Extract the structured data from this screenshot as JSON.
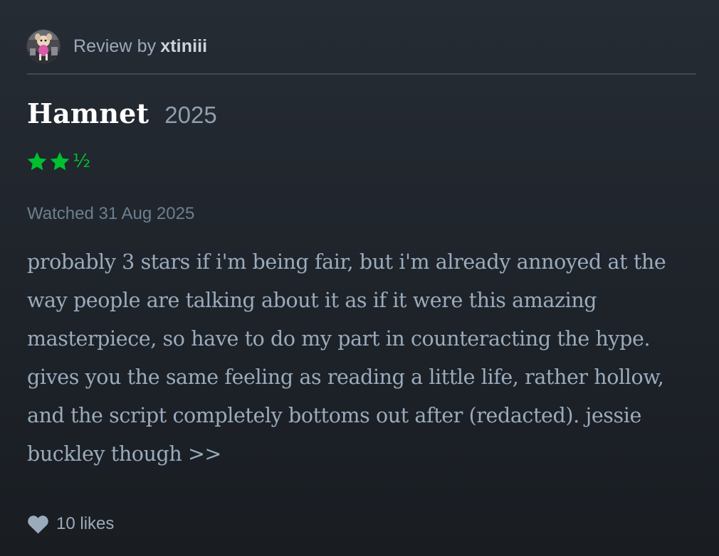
{
  "review": {
    "prefix": "Review by",
    "username": "xtiniii"
  },
  "film": {
    "title": "Hamnet",
    "year": "2025"
  },
  "rating": {
    "stars": 2.5,
    "max": 5,
    "half_glyph": "½",
    "color": "#00c030"
  },
  "watched": "Watched 31 Aug 2025",
  "body": "probably 3 stars if i'm being fair, but i'm already annoyed at the way people are talking about it as if it were this amazing masterpiece, so have to do my part in counteracting the hype. gives you the same feeling as reading a little life, rather hollow, and the script completely bottoms out after (redacted). jessie buckley though >>",
  "likes": {
    "label": "10 likes",
    "icon": "heart-icon"
  },
  "colors": {
    "background": "#1e232a",
    "title": "#ffffff",
    "text": "#9aabbc",
    "muted": "#6d7f8f",
    "divider": "#3f4954"
  }
}
